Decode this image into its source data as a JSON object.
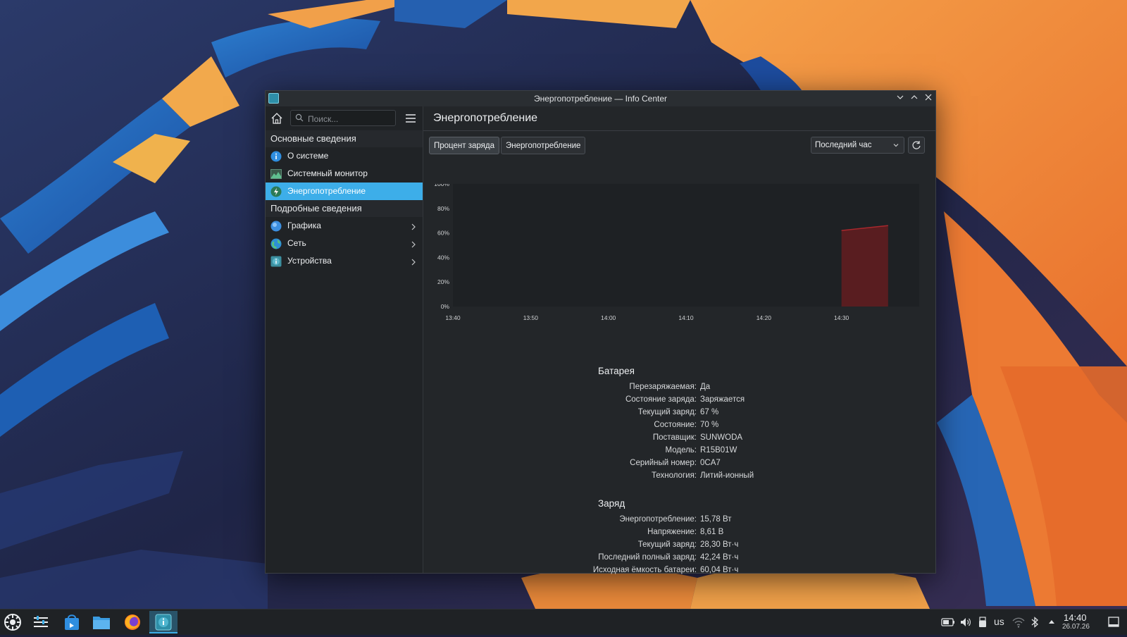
{
  "window": {
    "title": "Энергопотребление — Info Center"
  },
  "sidebar": {
    "search_placeholder": "Поиск...",
    "sections": [
      {
        "header": "Основные сведения",
        "items": [
          {
            "label": "О системе",
            "icon": "info-icon"
          },
          {
            "label": "Системный монитор",
            "icon": "system-monitor-icon"
          },
          {
            "label": "Энергопотребление",
            "icon": "energy-icon",
            "active": true
          }
        ]
      },
      {
        "header": "Подробные сведения",
        "items": [
          {
            "label": "Графика",
            "icon": "graphics-icon",
            "has_children": true
          },
          {
            "label": "Сеть",
            "icon": "network-icon",
            "has_children": true
          },
          {
            "label": "Устройства",
            "icon": "devices-icon",
            "has_children": true
          }
        ]
      }
    ]
  },
  "main": {
    "title": "Энергопотребление",
    "tabs": [
      {
        "label": "Процент заряда",
        "active": true
      },
      {
        "label": "Энергопотребление",
        "active": false
      }
    ],
    "period": "Последний час"
  },
  "chart_data": {
    "type": "area",
    "title": "",
    "xlabel": "",
    "ylabel": "",
    "y_ticks": [
      "100%",
      "80%",
      "60%",
      "40%",
      "20%",
      "0%"
    ],
    "x_ticks": [
      "13:40",
      "13:50",
      "14:00",
      "14:10",
      "14:20",
      "14:30"
    ],
    "ylim": [
      0,
      100
    ],
    "x_minutes": [
      820,
      880
    ],
    "series": [
      {
        "color": "#6e1c1f",
        "points": [
          {
            "x": "14:30",
            "y": 62
          },
          {
            "x": "14:36",
            "y": 66
          }
        ]
      }
    ],
    "grid": false
  },
  "battery": {
    "header": "Батарея",
    "rows": [
      {
        "key": "Перезаряжаемая:",
        "value": "Да"
      },
      {
        "key": "Состояние заряда:",
        "value": "Заряжается"
      },
      {
        "key": "Текущий заряд:",
        "value": "67 %"
      },
      {
        "key": "Состояние:",
        "value": "70 %"
      },
      {
        "key": "Поставщик:",
        "value": "SUNWODA"
      },
      {
        "key": "Модель:",
        "value": "R15B01W"
      },
      {
        "key": "Серийный номер:",
        "value": "0CA7"
      },
      {
        "key": "Технология:",
        "value": "Литий-ионный"
      }
    ]
  },
  "charge": {
    "header": "Заряд",
    "rows": [
      {
        "key": "Энергопотребление:",
        "value": "15,78 Вт"
      },
      {
        "key": "Напряжение:",
        "value": "8,61 В"
      },
      {
        "key": "Текущий заряд:",
        "value": "28,30 Вт·ч"
      },
      {
        "key": "Последний полный заряд:",
        "value": "42,24 Вт·ч"
      },
      {
        "key": "Исходная ёмкость батареи:",
        "value": "60,04 Вт·ч"
      }
    ]
  },
  "taskbar": {
    "apps": [
      "app-launcher-icon",
      "task-manager-icon",
      "discover-icon",
      "dolphin-icon",
      "firefox-icon",
      "info-center-icon"
    ],
    "keyboard_layout": "us",
    "time": "14:40",
    "date": "26.07.26"
  }
}
